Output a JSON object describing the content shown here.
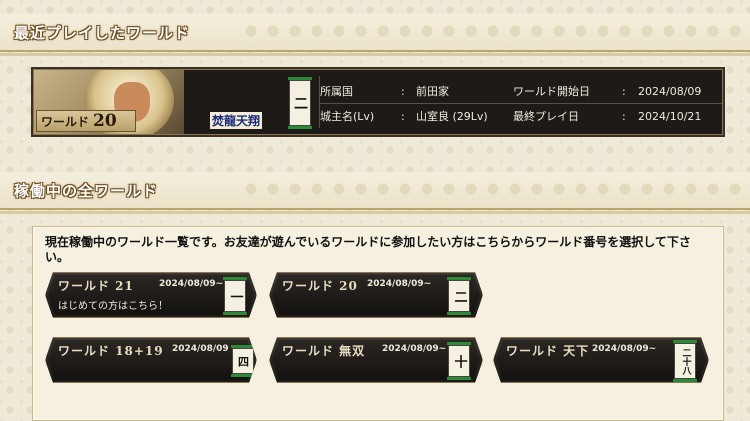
{
  "recent_section": {
    "title": "最近プレイしたワールド"
  },
  "recent_world": {
    "world_prefix": "ワールド",
    "world_number": "20",
    "crest_text": "焚龍天翔",
    "banner": "二",
    "fields": {
      "affiliation_label": "所属国",
      "affiliation_value": "前田家",
      "lord_label": "城主名(Lv)",
      "lord_value": "山室良 (29Lv)",
      "start_label": "ワールド開始日",
      "start_value": "2024/08/09",
      "last_label": "最終プレイ日",
      "last_value": "2024/10/21",
      "colon": ":"
    }
  },
  "active_section": {
    "title": "稼働中の全ワールド"
  },
  "active_panel": {
    "description": "現在稼働中のワールド一覧です。お友達が遊んでいるワールドに参加したい方はこちらからワールド番号を選択して下さい。",
    "worlds": [
      {
        "name": "ワールド 21",
        "date": "2024/08/09~",
        "banner": "一",
        "note": "はじめての方はこちら！"
      },
      {
        "name": "ワールド 20",
        "date": "2024/08/09~",
        "banner": "二",
        "note": ""
      },
      {
        "name": "ワールド 18+19",
        "date": "2024/08/09",
        "banner": "四",
        "note": ""
      },
      {
        "name": "ワールド 無双",
        "date": "2024/08/09~",
        "banner": "十",
        "note": ""
      },
      {
        "name": "ワールド 天下",
        "date": "2024/08/09~",
        "banner": "二十八",
        "note": ""
      }
    ]
  },
  "colors": {
    "accent_green": "#2a8a3a",
    "panel_dark": "#1e1a17",
    "gold_border": "#8a7650"
  }
}
